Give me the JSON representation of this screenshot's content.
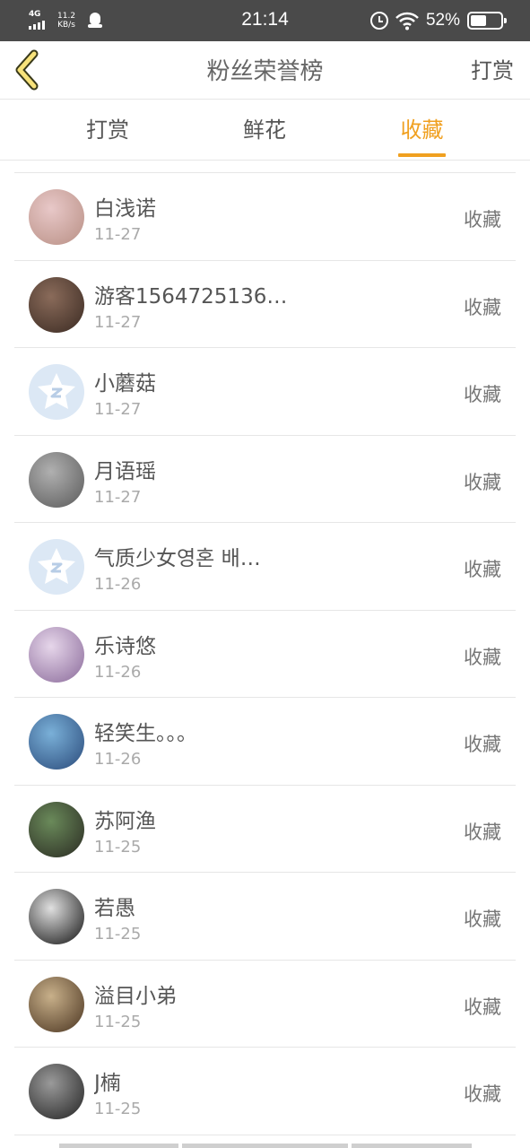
{
  "status_bar": {
    "network": "4G",
    "speed_value": "11.2",
    "speed_unit": "KB/s",
    "time": "21:14",
    "battery": "52%",
    "battery_level": 0.52
  },
  "header": {
    "title": "粉丝荣誉榜",
    "right_action": "打赏"
  },
  "tabs": [
    {
      "label": "打赏",
      "active": false
    },
    {
      "label": "鲜花",
      "active": false
    },
    {
      "label": "收藏",
      "active": true
    }
  ],
  "colors": {
    "accent": "#f0a020",
    "status_bar": "#4a4a4a",
    "divider": "#e6e6e6",
    "back_arrow_fill": "#f7e27a"
  },
  "fans": [
    {
      "name": "白浅诺",
      "date": "11-27",
      "action": "收藏",
      "avatar": "photo",
      "avatar_colors": [
        "#e8c8c8",
        "#b88f84"
      ]
    },
    {
      "name": "游客1564725136…",
      "date": "11-27",
      "action": "收藏",
      "avatar": "photo",
      "avatar_colors": [
        "#8a6b5a",
        "#3a2a22"
      ]
    },
    {
      "name": "小蘑菇",
      "date": "11-27",
      "action": "收藏",
      "avatar": "default",
      "avatar_colors": [
        "#dce8f5",
        "#ffffff"
      ]
    },
    {
      "name": "月语瑶",
      "date": "11-27",
      "action": "收藏",
      "avatar": "photo",
      "avatar_colors": [
        "#b0b0b0",
        "#5a5a5a"
      ]
    },
    {
      "name": "气质少女영혼 배…",
      "date": "11-26",
      "action": "收藏",
      "avatar": "default",
      "avatar_colors": [
        "#dce8f5",
        "#ffffff"
      ]
    },
    {
      "name": "乐诗悠",
      "date": "11-26",
      "action": "收藏",
      "avatar": "photo",
      "avatar_colors": [
        "#e6d6ea",
        "#8a6a9a"
      ]
    },
    {
      "name": "轻笑生。。。",
      "date": "11-26",
      "action": "收藏",
      "avatar": "photo",
      "avatar_colors": [
        "#7ab0d8",
        "#2a4a7a"
      ]
    },
    {
      "name": "苏阿渔",
      "date": "11-25",
      "action": "收藏",
      "avatar": "photo",
      "avatar_colors": [
        "#6a8a5a",
        "#2a2a22"
      ]
    },
    {
      "name": "若愚",
      "date": "11-25",
      "action": "收藏",
      "avatar": "photo",
      "avatar_colors": [
        "#e0e0e0",
        "#111111"
      ]
    },
    {
      "name": "溢目小弟",
      "date": "11-25",
      "action": "收藏",
      "avatar": "photo",
      "avatar_colors": [
        "#c8b08a",
        "#4a3420"
      ]
    },
    {
      "name": "J楠",
      "date": "11-25",
      "action": "收藏",
      "avatar": "photo",
      "avatar_colors": [
        "#9a9a9a",
        "#222222"
      ]
    }
  ]
}
